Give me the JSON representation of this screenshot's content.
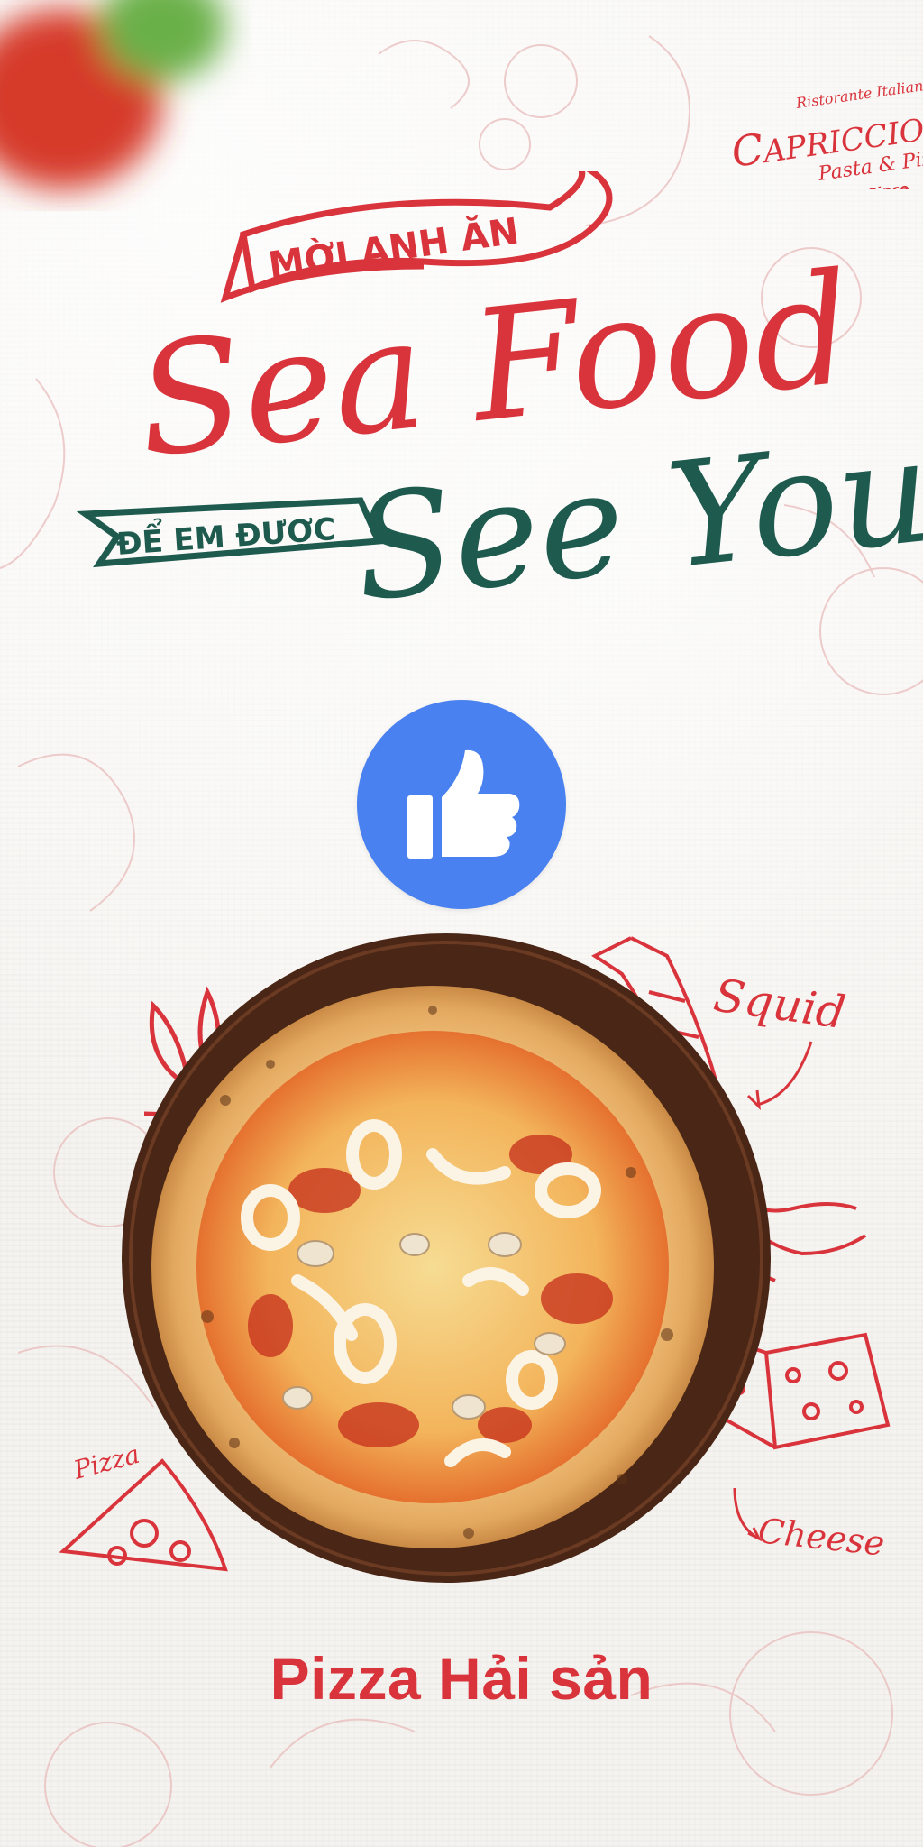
{
  "brand": {
    "tagline": "Ristorante Italiano",
    "name": "CAPRICCIOSA",
    "subtitle": "Pasta & Pizza",
    "since": "Since"
  },
  "headline": {
    "ribbon_top": "MỜI ANH ĂN",
    "script_top": "Sea Food",
    "ribbon_bottom": "ĐỂ EM ĐƯỢC",
    "script_bottom": "See You"
  },
  "annotations": {
    "squid": "Squid",
    "cheese": "Cheese",
    "pizza": "Pizza"
  },
  "product": {
    "name": "Pizza Hải sản"
  },
  "colors": {
    "red": "#d9343c",
    "green": "#1e5a4e",
    "like_blue": "#4a81f0"
  },
  "icons": [
    "like-thumbs-up-icon",
    "squid-sketch-icon",
    "cheese-sketch-icon",
    "pizza-slice-sketch-icon",
    "splash-lines-icon"
  ]
}
